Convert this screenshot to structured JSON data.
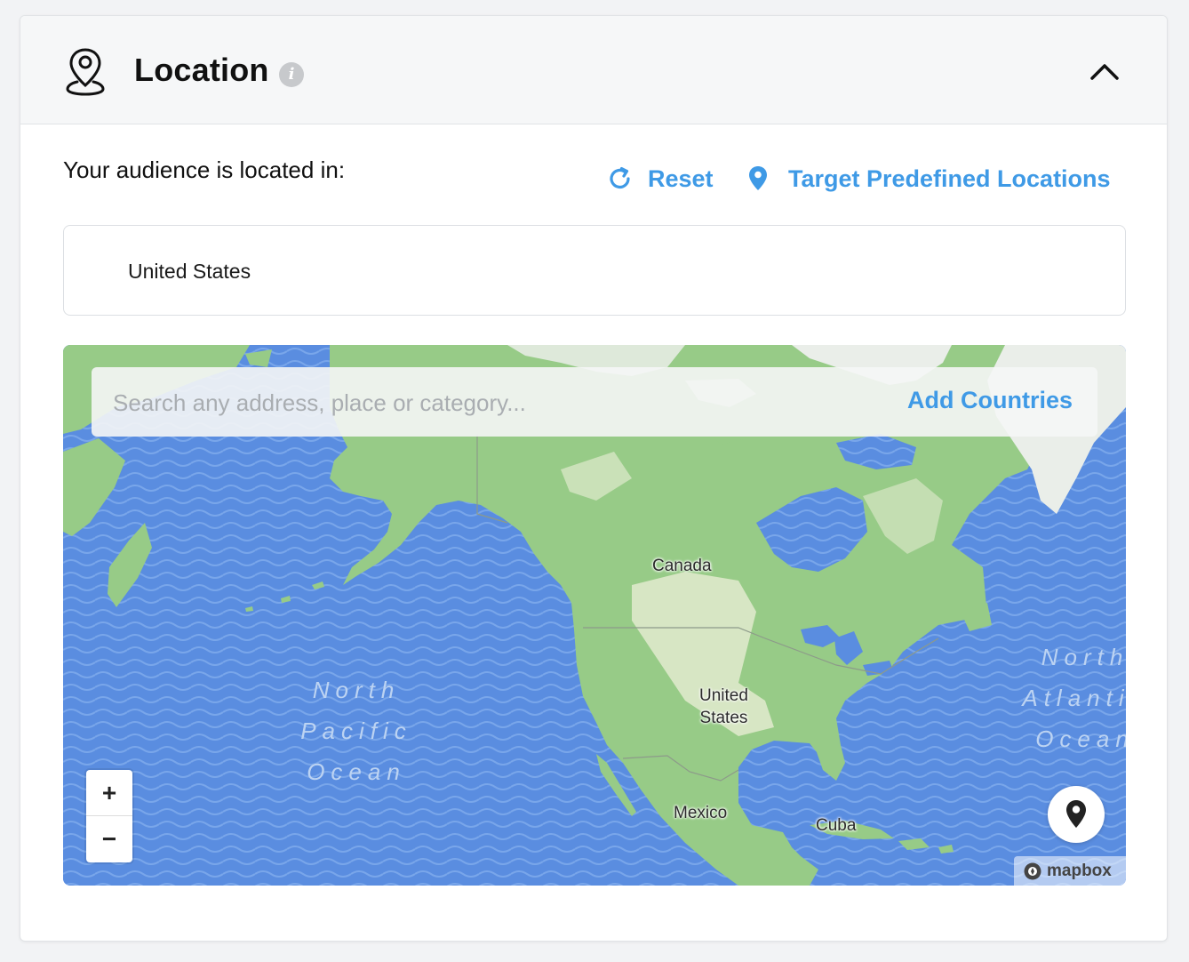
{
  "header": {
    "title": "Location",
    "info_icon": "info-icon",
    "pin_icon": "location-pin-icon",
    "collapse_icon": "chevron-up-icon"
  },
  "audience": {
    "label": "Your audience is located in:",
    "reset_label": "Reset",
    "predefined_label": "Target Predefined Locations",
    "selected_locations": [
      "United States"
    ]
  },
  "map": {
    "search_placeholder": "Search any address, place or category...",
    "add_countries_label": "Add Countries",
    "labels": {
      "canada": "Canada",
      "united_states": "United\nStates",
      "mexico": "Mexico",
      "cuba": "Cuba"
    },
    "oceans": {
      "north_pacific": "North\nPacific\nOcean",
      "north_atlantic": "North\nAtlantic\nOcean"
    },
    "zoom_in_label": "+",
    "zoom_out_label": "−",
    "attribution": "mapbox",
    "colors": {
      "water": "#5a8de0",
      "land": "#97cb87",
      "land_light": "#d7e6c4",
      "ice": "#eaeee9"
    }
  },
  "colors": {
    "accent": "#3f9ae6",
    "info_gray": "#c7c9cc"
  }
}
